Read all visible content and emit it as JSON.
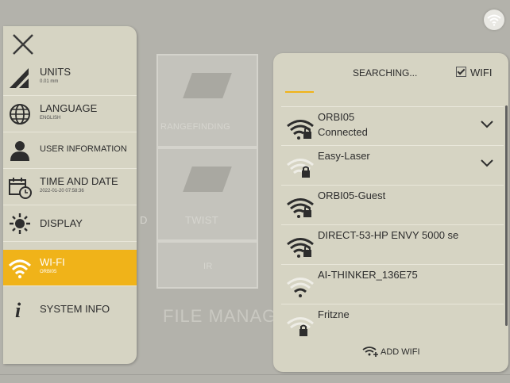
{
  "background": {
    "tile_labels": [
      "RANGEFINDING",
      "TWIST",
      "IR",
      "D"
    ],
    "file_label": "FILE MANAG"
  },
  "menu": {
    "close_icon": "close-icon",
    "items": [
      {
        "label": "UNITS",
        "sub": "0.01 mm",
        "icon": "ruler-triangle-icon"
      },
      {
        "label": "LANGUAGE",
        "sub": "ENGLISH",
        "icon": "globe-icon"
      },
      {
        "label": "USER INFORMATION",
        "sub": "",
        "icon": "user-icon"
      },
      {
        "label": "TIME AND DATE",
        "sub": "2022-01-20 07:58:36",
        "icon": "calendar-clock-icon"
      },
      {
        "label": "DISPLAY",
        "sub": "",
        "icon": "brightness-icon"
      },
      {
        "label": "WI-FI",
        "sub": "ORBI05",
        "icon": "wifi-icon"
      },
      {
        "label": "SYSTEM INFO",
        "sub": "",
        "icon": "info-icon"
      }
    ],
    "active_index": 5
  },
  "wifi_panel": {
    "searching": "SEARCHING...",
    "wifi_toggle_label": "WIFI",
    "wifi_enabled": true,
    "networks": [
      {
        "name": "ORBI05",
        "status": "Connected",
        "signal": "strong",
        "locked": true,
        "expandable": true
      },
      {
        "name": "Easy-Laser",
        "status": "",
        "signal": "weak",
        "locked": true,
        "expandable": true
      },
      {
        "name": "ORBI05-Guest",
        "status": "",
        "signal": "strong",
        "locked": true,
        "expandable": false
      },
      {
        "name": "DIRECT-53-HP ENVY 5000 se",
        "status": "",
        "signal": "strong",
        "locked": true,
        "expandable": false
      },
      {
        "name": "AI-THINKER_136E75",
        "status": "",
        "signal": "weak",
        "locked": false,
        "expandable": false
      },
      {
        "name": "Fritzne",
        "status": "",
        "signal": "weak",
        "locked": true,
        "expandable": false
      }
    ],
    "add_wifi": "ADD WIFI"
  },
  "colors": {
    "accent": "#f0b319",
    "panel": "#d6d4c3"
  }
}
